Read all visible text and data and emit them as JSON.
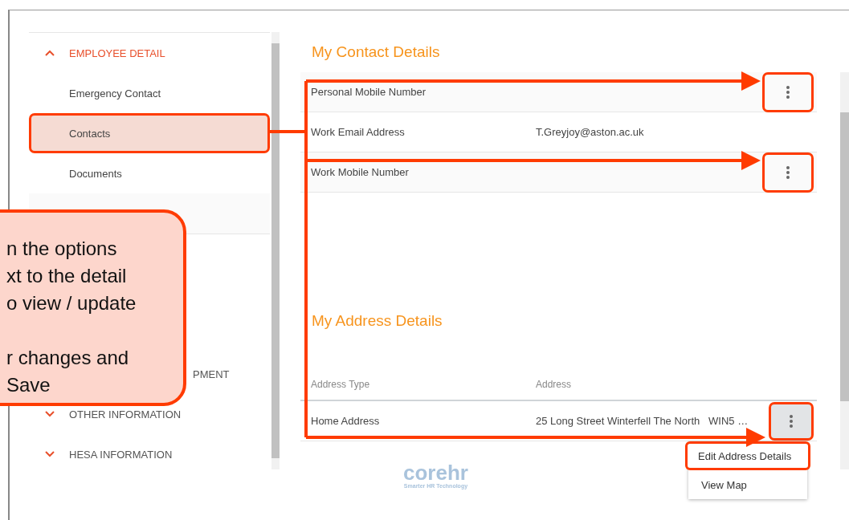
{
  "sidebar": {
    "sections": [
      {
        "label": "EMPLOYEE DETAIL",
        "expanded": true,
        "children": [
          {
            "label": "Emergency Contact",
            "selected": false
          },
          {
            "label": "Contacts",
            "selected": true
          },
          {
            "label": "Documents",
            "selected": false
          }
        ]
      },
      {
        "label": "PMENT"
      },
      {
        "label": "OTHER INFORMATION",
        "expanded": false
      },
      {
        "label": "HESA INFORMATION",
        "expanded": false
      }
    ]
  },
  "contact_details": {
    "title": "My Contact Details",
    "rows": [
      {
        "label": "Personal Mobile Number",
        "menu": {
          "highlighted": true
        }
      },
      {
        "label": "Work Email Address",
        "value": "T.Greyjoy@aston.ac.uk"
      },
      {
        "label": "Work Mobile Number",
        "menu": {
          "highlighted": true
        }
      }
    ]
  },
  "address_details": {
    "title": "My Address Details",
    "columns": [
      "Address Type",
      "Address"
    ],
    "rows": [
      {
        "cells": [
          "Home Address",
          "25 Long Street Winterfell The North   WIN5 …"
        ],
        "menu": {
          "highlighted": true,
          "open": true
        }
      }
    ],
    "menu_items": [
      {
        "label": "Edit Address Details",
        "highlighted": true
      },
      {
        "label": "View Map",
        "highlighted": false
      }
    ]
  },
  "logo": {
    "name": "corehr",
    "tagline": "Smarter HR Technology"
  },
  "callout": {
    "paragraphs": [
      [
        "n the options",
        "xt to the detail",
        "o view / update"
      ],
      [
        "r changes and",
        "Save"
      ]
    ]
  }
}
